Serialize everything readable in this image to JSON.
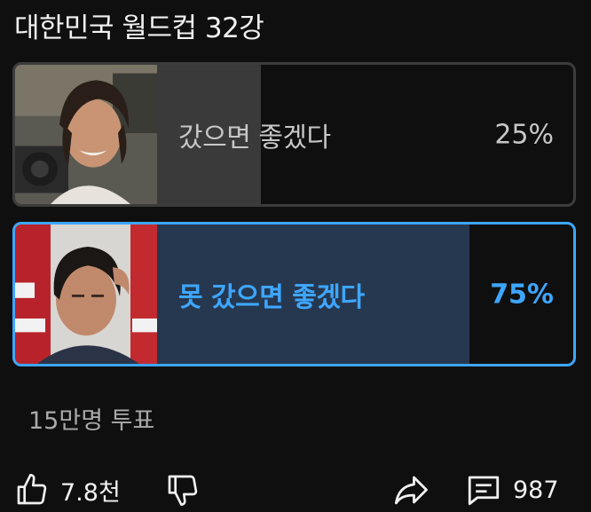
{
  "post": {
    "title": "대한민국 월드컵 32강"
  },
  "poll": {
    "options": [
      {
        "label": "갔으면 좋겠다",
        "percent_label": "25%",
        "share": 0.25,
        "selected": false
      },
      {
        "label": "못 갔으면 좋겠다",
        "percent_label": "75%",
        "share": 0.75,
        "selected": true
      }
    ],
    "votes_label": "15만명 투표"
  },
  "actions": {
    "like_count": "7.8천",
    "comment_count": "987"
  },
  "colors": {
    "background": "#0f0f0f",
    "accent": "#3ea6ff",
    "selected_fill": "#263850",
    "unselected_fill": "#3a3a3a"
  },
  "icons": {
    "like": "thumbs-up-icon",
    "dislike": "thumbs-down-icon",
    "share": "share-arrow-icon",
    "comments": "comment-icon"
  }
}
